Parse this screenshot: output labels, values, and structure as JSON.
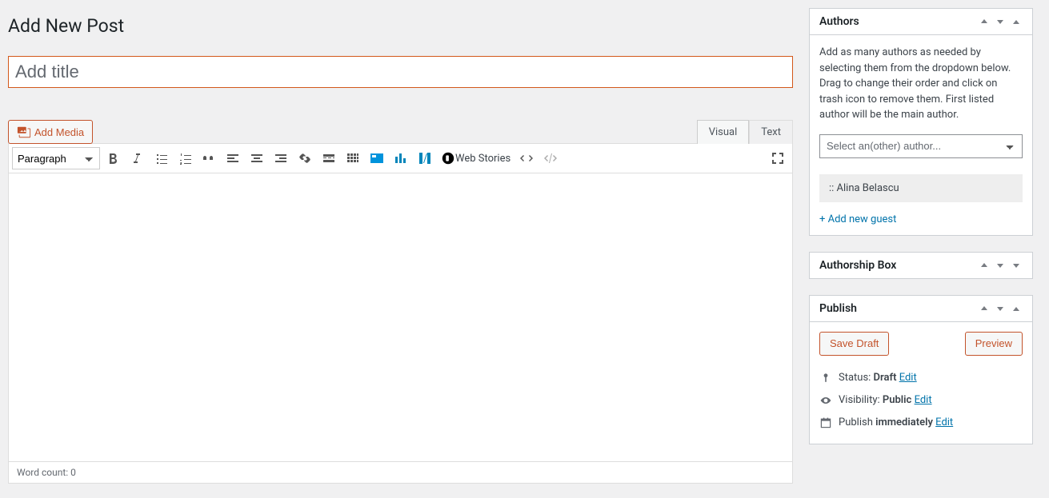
{
  "page_title": "Add New Post",
  "title_placeholder": "Add title",
  "add_media_label": "Add Media",
  "tabs": {
    "visual": "Visual",
    "text": "Text"
  },
  "format_select": "Paragraph",
  "web_stories_label": "Web Stories",
  "word_count_label": "Word count: 0",
  "authors_panel": {
    "title": "Authors",
    "help": "Add as many authors as needed by selecting them from the dropdown below. Drag to change their order and click on trash icon to remove them. First listed author will be the main author.",
    "select_placeholder": "Select an(other) author...",
    "author_chip": ":: Alina Belascu",
    "add_guest": "+ Add new guest"
  },
  "authorship_box": {
    "title": "Authorship Box"
  },
  "publish_panel": {
    "title": "Publish",
    "save_draft": "Save Draft",
    "preview": "Preview",
    "status_label": "Status: ",
    "status_value": "Draft",
    "visibility_label": "Visibility: ",
    "visibility_value": "Public",
    "publish_label": "Publish ",
    "publish_value": "immediately",
    "edit": "Edit"
  }
}
